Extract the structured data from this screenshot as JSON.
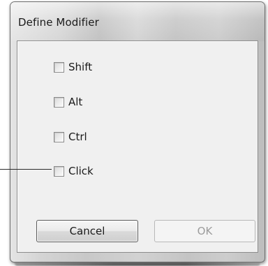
{
  "window": {
    "title": "Define Modifier"
  },
  "modifiers": [
    {
      "label": "Shift",
      "checked": false
    },
    {
      "label": "Alt",
      "checked": false
    },
    {
      "label": "Ctrl",
      "checked": false
    },
    {
      "label": "Click",
      "checked": false
    }
  ],
  "buttons": {
    "cancel_label": "Cancel",
    "ok_label": "OK",
    "ok_enabled": false
  }
}
